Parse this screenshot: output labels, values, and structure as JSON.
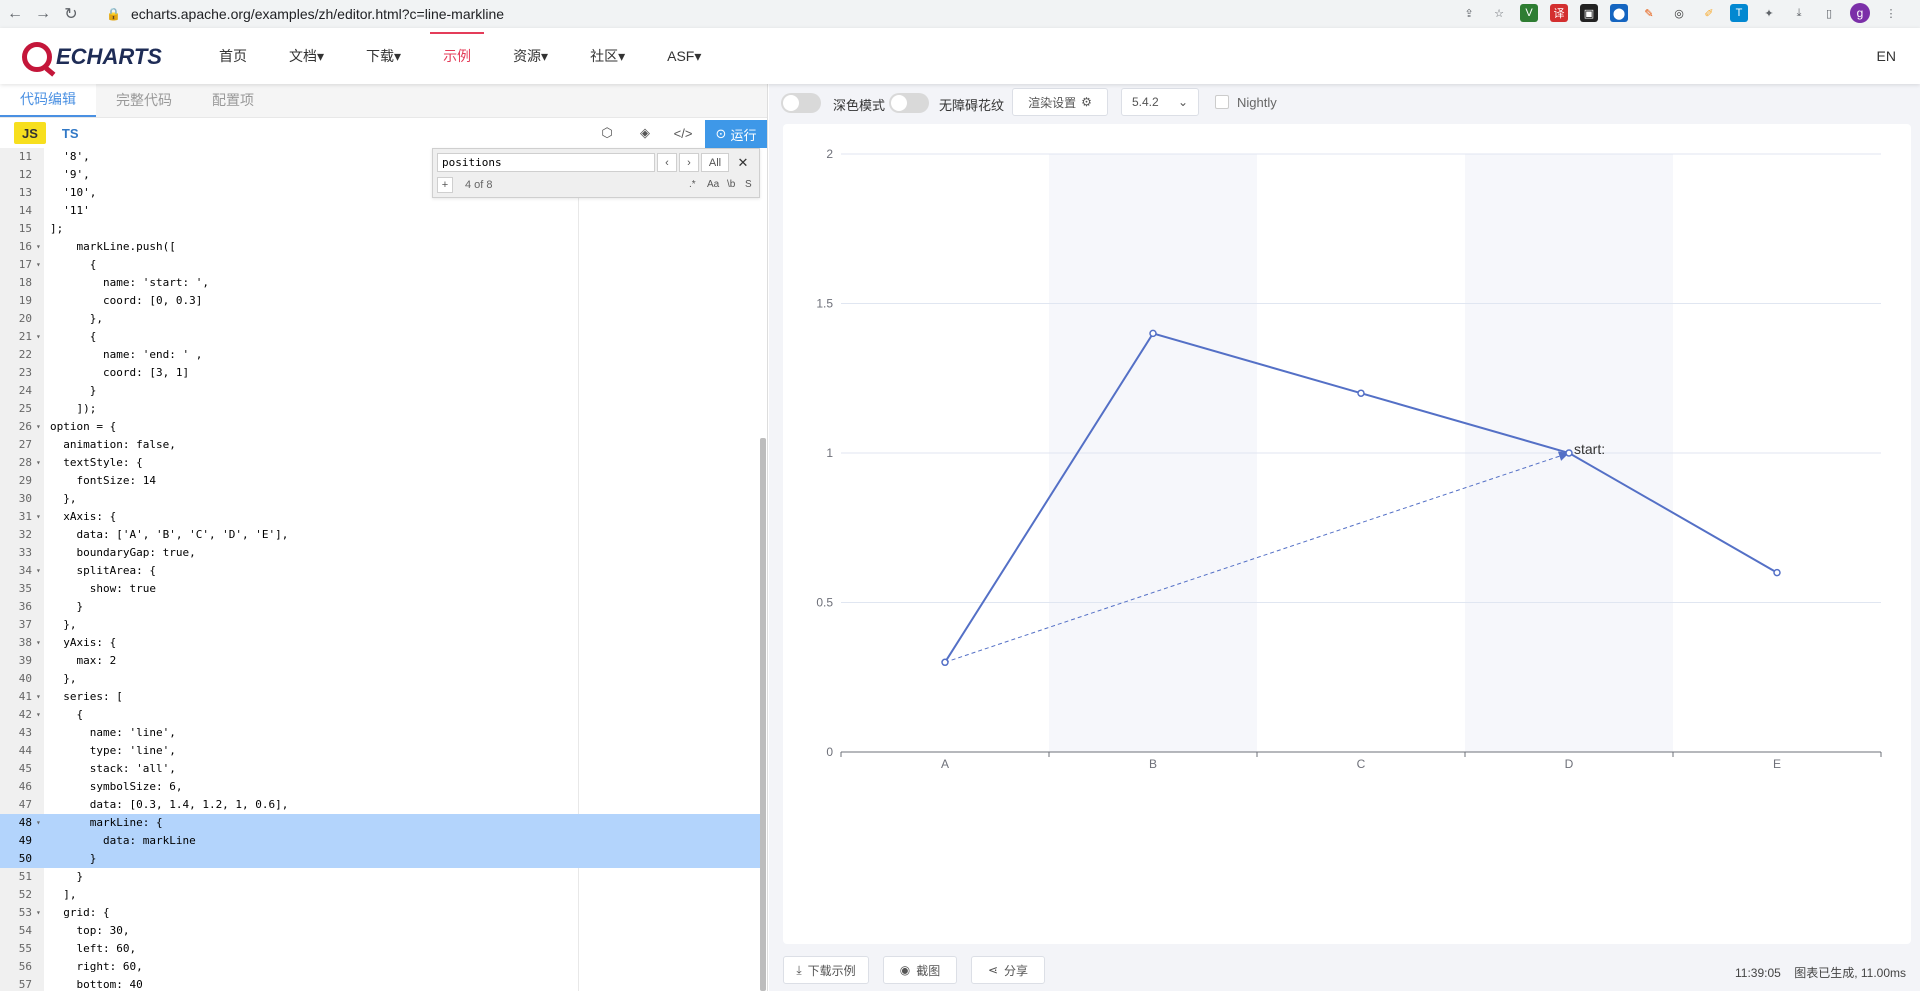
{
  "browser": {
    "url": "echarts.apache.org/examples/zh/editor.html?c=line-markline",
    "avatar_letter": "g"
  },
  "site": {
    "logo_text": "ECHARTS",
    "nav": [
      {
        "label": "首页"
      },
      {
        "label": "文档▾"
      },
      {
        "label": "下载▾"
      },
      {
        "label": "示例"
      },
      {
        "label": "资源▾"
      },
      {
        "label": "社区▾"
      },
      {
        "label": "ASF▾"
      }
    ],
    "lang": "EN",
    "accent": "#e43c59"
  },
  "editor": {
    "tabs": [
      "代码编辑",
      "完整代码",
      "配置项"
    ],
    "js_label": "JS",
    "ts_label": "TS",
    "run_label": "运行",
    "search": {
      "query": "positions",
      "count": "4 of 8",
      "all_label": "All",
      "plus_label": "+",
      "opt_regex": ".*",
      "opt_case": "Aa",
      "opt_word": "\\b",
      "opt_sel": "S"
    },
    "lines": [
      {
        "n": "11",
        "f": "",
        "t": "  '8',"
      },
      {
        "n": "12",
        "f": "",
        "t": "  '9',"
      },
      {
        "n": "13",
        "f": "",
        "t": "  '10',"
      },
      {
        "n": "14",
        "f": "",
        "t": "  '11'"
      },
      {
        "n": "15",
        "f": "",
        "t": "];"
      },
      {
        "n": "16",
        "f": "▾",
        "t": "    markLine.push(["
      },
      {
        "n": "17",
        "f": "▾",
        "t": "      {"
      },
      {
        "n": "18",
        "f": "",
        "t": "        name: 'start: ',"
      },
      {
        "n": "19",
        "f": "",
        "t": "        coord: [0, 0.3]"
      },
      {
        "n": "20",
        "f": "",
        "t": "      },"
      },
      {
        "n": "21",
        "f": "▾",
        "t": "      {"
      },
      {
        "n": "22",
        "f": "",
        "t": "        name: 'end: ' ,"
      },
      {
        "n": "23",
        "f": "",
        "t": "        coord: [3, 1]"
      },
      {
        "n": "24",
        "f": "",
        "t": "      }"
      },
      {
        "n": "25",
        "f": "",
        "t": "    ]);"
      },
      {
        "n": "26",
        "f": "▾",
        "t": "option = {"
      },
      {
        "n": "27",
        "f": "",
        "t": "  animation: false,"
      },
      {
        "n": "28",
        "f": "▾",
        "t": "  textStyle: {"
      },
      {
        "n": "29",
        "f": "",
        "t": "    fontSize: 14"
      },
      {
        "n": "30",
        "f": "",
        "t": "  },"
      },
      {
        "n": "31",
        "f": "▾",
        "t": "  xAxis: {"
      },
      {
        "n": "32",
        "f": "",
        "t": "    data: ['A', 'B', 'C', 'D', 'E'],"
      },
      {
        "n": "33",
        "f": "",
        "t": "    boundaryGap: true,"
      },
      {
        "n": "34",
        "f": "▾",
        "t": "    splitArea: {"
      },
      {
        "n": "35",
        "f": "",
        "t": "      show: true"
      },
      {
        "n": "36",
        "f": "",
        "t": "    }"
      },
      {
        "n": "37",
        "f": "",
        "t": "  },"
      },
      {
        "n": "38",
        "f": "▾",
        "t": "  yAxis: {"
      },
      {
        "n": "39",
        "f": "",
        "t": "    max: 2"
      },
      {
        "n": "40",
        "f": "",
        "t": "  },"
      },
      {
        "n": "41",
        "f": "▾",
        "t": "  series: ["
      },
      {
        "n": "42",
        "f": "▾",
        "t": "    {"
      },
      {
        "n": "43",
        "f": "",
        "t": "      name: 'line',"
      },
      {
        "n": "44",
        "f": "",
        "t": "      type: 'line',"
      },
      {
        "n": "45",
        "f": "",
        "t": "      stack: 'all',"
      },
      {
        "n": "46",
        "f": "",
        "t": "      symbolSize: 6,"
      },
      {
        "n": "47",
        "f": "",
        "t": "      data: [0.3, 1.4, 1.2, 1, 0.6],"
      },
      {
        "n": "48",
        "f": "▾",
        "t": "      markLine: {",
        "hl": true
      },
      {
        "n": "49",
        "f": "",
        "t": "        data: markLine",
        "hl": true
      },
      {
        "n": "50",
        "f": "",
        "t": "      }",
        "hl": true
      },
      {
        "n": "51",
        "f": "",
        "t": "    }"
      },
      {
        "n": "52",
        "f": "",
        "t": "  ],"
      },
      {
        "n": "53",
        "f": "▾",
        "t": "  grid: {"
      },
      {
        "n": "54",
        "f": "",
        "t": "    top: 30,"
      },
      {
        "n": "55",
        "f": "",
        "t": "    left: 60,"
      },
      {
        "n": "56",
        "f": "",
        "t": "    right: 60,"
      },
      {
        "n": "57",
        "f": "",
        "t": "    bottom: 40"
      }
    ]
  },
  "preview": {
    "dark_mode_label": "深色模式",
    "aria_label": "无障碍花纹",
    "render_label": "渲染设置",
    "version_label": "5.4.2",
    "nightly_label": "Nightly",
    "download_label": "下载示例",
    "screenshot_label": "截图",
    "share_label": "分享",
    "status_time": "11:39:05",
    "status_text": "图表已生成, 11.00ms"
  },
  "chart_data": {
    "type": "line",
    "categories": [
      "A",
      "B",
      "C",
      "D",
      "E"
    ],
    "series": [
      {
        "values": [
          0.3,
          1.4,
          1.2,
          1,
          0.6
        ],
        "color": "#5470c6"
      }
    ],
    "ylim": [
      0,
      2
    ],
    "yticks": [
      0,
      0.5,
      1,
      1.5,
      2
    ],
    "ytick_labels": [
      "0",
      "0.5",
      "1",
      "1.5",
      "2"
    ],
    "split_area": true,
    "markline": {
      "from": [
        0,
        0.3
      ],
      "to": [
        3,
        1
      ],
      "label": "start:",
      "style": "dashed"
    }
  }
}
